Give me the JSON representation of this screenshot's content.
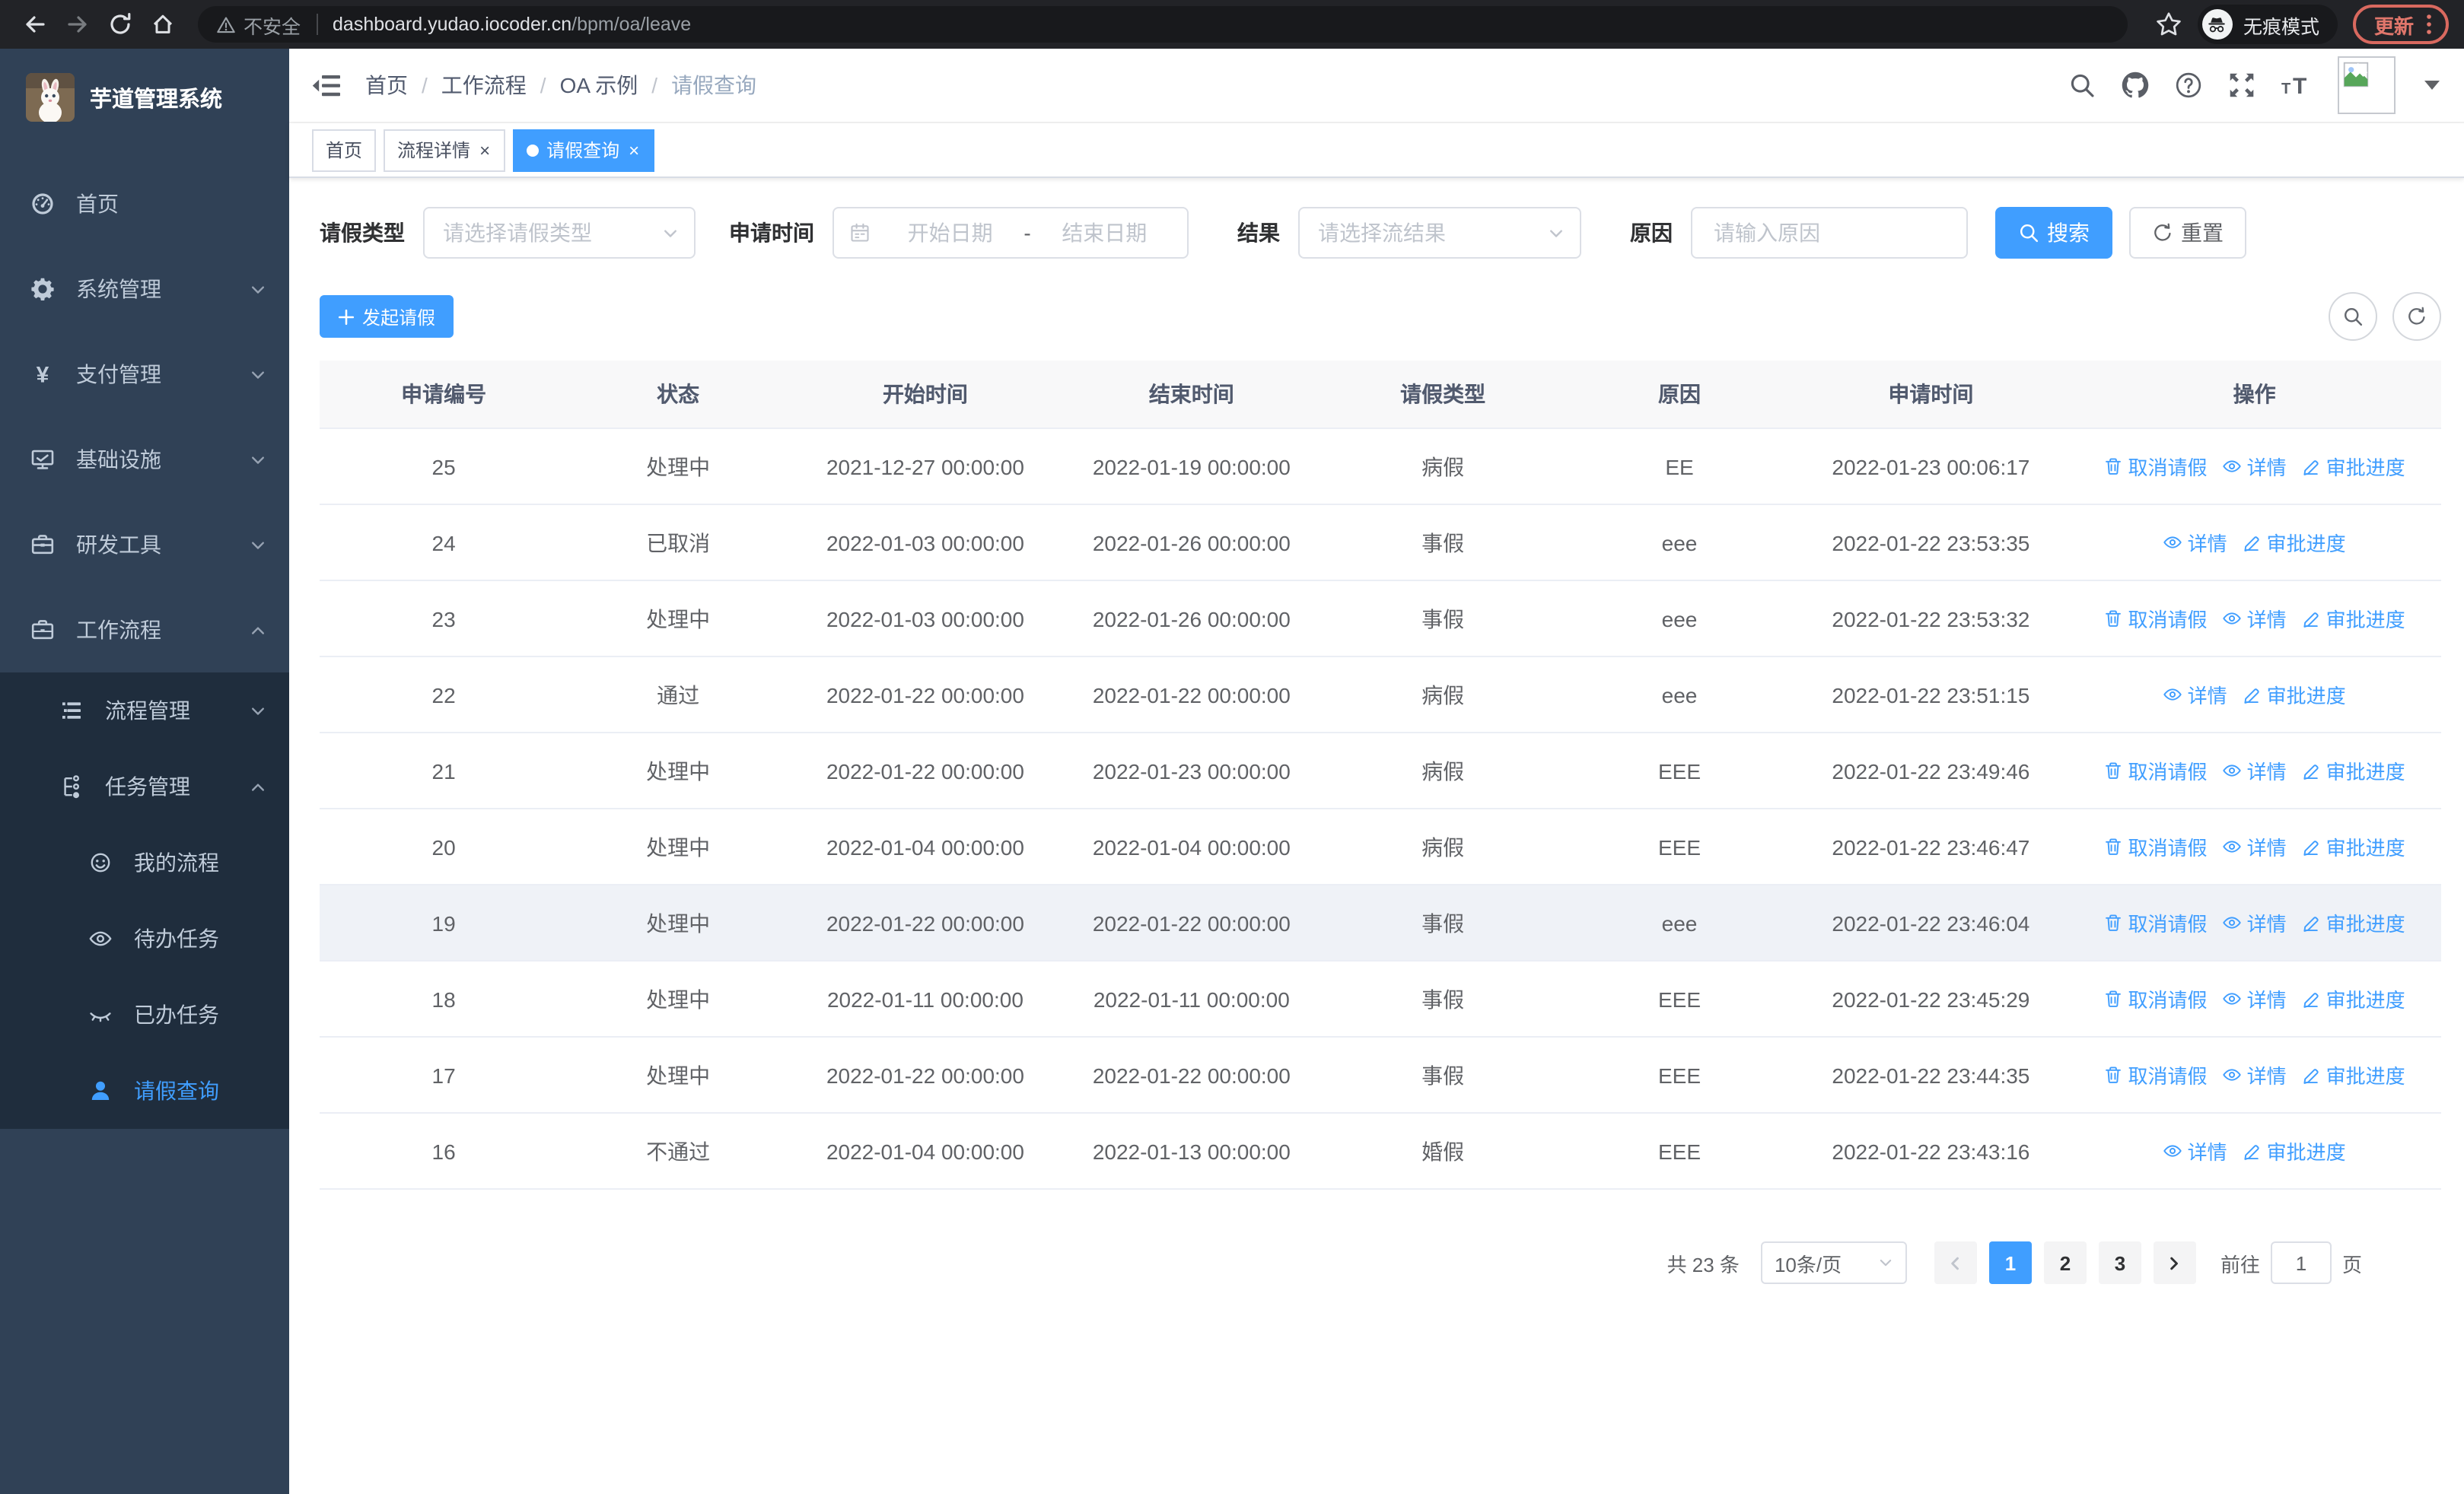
{
  "browser": {
    "security_warning": "不安全",
    "url_domain": "dashboard.yudao.iocoder.cn",
    "url_path": "/bpm/oa/leave",
    "incognito_label": "无痕模式",
    "update_label": "更新"
  },
  "sidebar": {
    "title": "芋道管理系统",
    "menu": [
      {
        "id": "home",
        "label": "首页",
        "icon": "dashboard-icon",
        "level": 1
      },
      {
        "id": "system",
        "label": "系统管理",
        "icon": "gear-icon",
        "level": 1,
        "chevron": "down"
      },
      {
        "id": "payment",
        "label": "支付管理",
        "icon": "yen-icon",
        "level": 1,
        "chevron": "down"
      },
      {
        "id": "infra",
        "label": "基础设施",
        "icon": "monitor-icon",
        "level": 1,
        "chevron": "down"
      },
      {
        "id": "devtools",
        "label": "研发工具",
        "icon": "toolbox-icon",
        "level": 1,
        "chevron": "down"
      },
      {
        "id": "workflow",
        "label": "工作流程",
        "icon": "briefcase-icon",
        "level": 1,
        "chevron": "up"
      },
      {
        "id": "process-mgmt",
        "label": "流程管理",
        "icon": "list-icon",
        "level": 2,
        "chevron": "down",
        "dark": true
      },
      {
        "id": "task-mgmt",
        "label": "任务管理",
        "icon": "tree-icon",
        "level": 2,
        "chevron": "up",
        "dark": true
      },
      {
        "id": "my-process",
        "label": "我的流程",
        "icon": "face-icon",
        "level": 3,
        "dark": true
      },
      {
        "id": "todo-task",
        "label": "待办任务",
        "icon": "eye-icon",
        "level": 3,
        "dark": true
      },
      {
        "id": "done-task",
        "label": "已办任务",
        "icon": "eye-closed-icon",
        "level": 3,
        "dark": true
      },
      {
        "id": "leave-query",
        "label": "请假查询",
        "icon": "user-icon",
        "level": 3,
        "dark": true,
        "active": true
      }
    ]
  },
  "header": {
    "breadcrumb": [
      "首页",
      "工作流程",
      "OA 示例",
      "请假查询"
    ]
  },
  "tabs": [
    {
      "label": "首页",
      "closable": false,
      "active": false
    },
    {
      "label": "流程详情",
      "closable": true,
      "active": false
    },
    {
      "label": "请假查询",
      "closable": true,
      "active": true
    }
  ],
  "filters": {
    "leave_type_label": "请假类型",
    "leave_type_placeholder": "请选择请假类型",
    "apply_time_label": "申请时间",
    "start_date_placeholder": "开始日期",
    "range_separator": "-",
    "end_date_placeholder": "结束日期",
    "result_label": "结果",
    "result_placeholder": "请选择流结果",
    "reason_label": "原因",
    "reason_placeholder": "请输入原因",
    "search_label": "搜索",
    "reset_label": "重置"
  },
  "toolbar": {
    "create_label": "发起请假"
  },
  "table": {
    "columns": [
      "申请编号",
      "状态",
      "开始时间",
      "结束时间",
      "请假类型",
      "原因",
      "申请时间",
      "操作"
    ],
    "action_labels": {
      "cancel": "取消请假",
      "detail": "详情",
      "progress": "审批进度"
    },
    "rows": [
      {
        "id": "25",
        "status": "处理中",
        "start": "2021-12-27 00:00:00",
        "end": "2022-01-19 00:00:00",
        "type": "病假",
        "reason": "EE",
        "applied": "2022-01-23 00:06:17",
        "actions": [
          "cancel",
          "detail",
          "progress"
        ]
      },
      {
        "id": "24",
        "status": "已取消",
        "start": "2022-01-03 00:00:00",
        "end": "2022-01-26 00:00:00",
        "type": "事假",
        "reason": "eee",
        "applied": "2022-01-22 23:53:35",
        "actions": [
          "detail",
          "progress"
        ]
      },
      {
        "id": "23",
        "status": "处理中",
        "start": "2022-01-03 00:00:00",
        "end": "2022-01-26 00:00:00",
        "type": "事假",
        "reason": "eee",
        "applied": "2022-01-22 23:53:32",
        "actions": [
          "cancel",
          "detail",
          "progress"
        ]
      },
      {
        "id": "22",
        "status": "通过",
        "start": "2022-01-22 00:00:00",
        "end": "2022-01-22 00:00:00",
        "type": "病假",
        "reason": "eee",
        "applied": "2022-01-22 23:51:15",
        "actions": [
          "detail",
          "progress"
        ]
      },
      {
        "id": "21",
        "status": "处理中",
        "start": "2022-01-22 00:00:00",
        "end": "2022-01-23 00:00:00",
        "type": "病假",
        "reason": "EEE",
        "applied": "2022-01-22 23:49:46",
        "actions": [
          "cancel",
          "detail",
          "progress"
        ]
      },
      {
        "id": "20",
        "status": "处理中",
        "start": "2022-01-04 00:00:00",
        "end": "2022-01-04 00:00:00",
        "type": "病假",
        "reason": "EEE",
        "applied": "2022-01-22 23:46:47",
        "actions": [
          "cancel",
          "detail",
          "progress"
        ]
      },
      {
        "id": "19",
        "status": "处理中",
        "start": "2022-01-22 00:00:00",
        "end": "2022-01-22 00:00:00",
        "type": "事假",
        "reason": "eee",
        "applied": "2022-01-22 23:46:04",
        "actions": [
          "cancel",
          "detail",
          "progress"
        ],
        "highlighted": true
      },
      {
        "id": "18",
        "status": "处理中",
        "start": "2022-01-11 00:00:00",
        "end": "2022-01-11 00:00:00",
        "type": "事假",
        "reason": "EEE",
        "applied": "2022-01-22 23:45:29",
        "actions": [
          "cancel",
          "detail",
          "progress"
        ]
      },
      {
        "id": "17",
        "status": "处理中",
        "start": "2022-01-22 00:00:00",
        "end": "2022-01-22 00:00:00",
        "type": "事假",
        "reason": "EEE",
        "applied": "2022-01-22 23:44:35",
        "actions": [
          "cancel",
          "detail",
          "progress"
        ]
      },
      {
        "id": "16",
        "status": "不通过",
        "start": "2022-01-04 00:00:00",
        "end": "2022-01-13 00:00:00",
        "type": "婚假",
        "reason": "EEE",
        "applied": "2022-01-22 23:43:16",
        "actions": [
          "detail",
          "progress"
        ]
      }
    ]
  },
  "pagination": {
    "total_text": "共 23 条",
    "page_size": "10条/页",
    "pages": [
      "1",
      "2",
      "3"
    ],
    "active_page": "1",
    "goto_label": "前往",
    "goto_value": "1",
    "page_suffix": "页"
  },
  "colors": {
    "accent": "#409eff",
    "sidebar_bg": "#304156",
    "submenu_bg": "#1f2d3d"
  }
}
